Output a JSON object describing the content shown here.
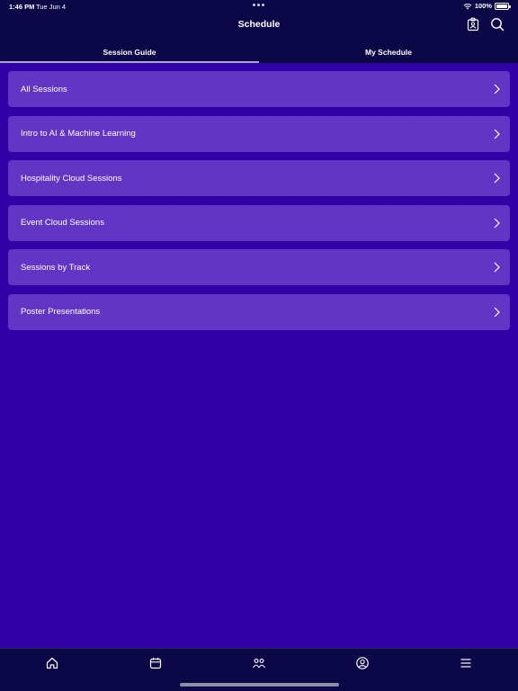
{
  "status_bar": {
    "time": "1:46 PM",
    "date": "Tue Jun 4",
    "battery": "100%"
  },
  "header": {
    "title": "Schedule",
    "icons": [
      "badge-icon",
      "search-icon"
    ]
  },
  "tabs": [
    {
      "label": "Session Guide",
      "active": true
    },
    {
      "label": "My Schedule",
      "active": false
    }
  ],
  "sessions": [
    {
      "label": "All Sessions"
    },
    {
      "label": "Intro to AI & Machine Learning"
    },
    {
      "label": "Hospitality Cloud Sessions"
    },
    {
      "label": "Event Cloud Sessions"
    },
    {
      "label": "Sessions by Track"
    },
    {
      "label": "Poster Presentations"
    }
  ],
  "tab_bar": {
    "items": [
      "home-icon",
      "calendar-icon",
      "people-icon",
      "profile-icon",
      "menu-icon"
    ],
    "active": "calendar-icon"
  },
  "colors": {
    "background": "#3300a8",
    "header": "#0c0747",
    "row": "#6335c4"
  }
}
